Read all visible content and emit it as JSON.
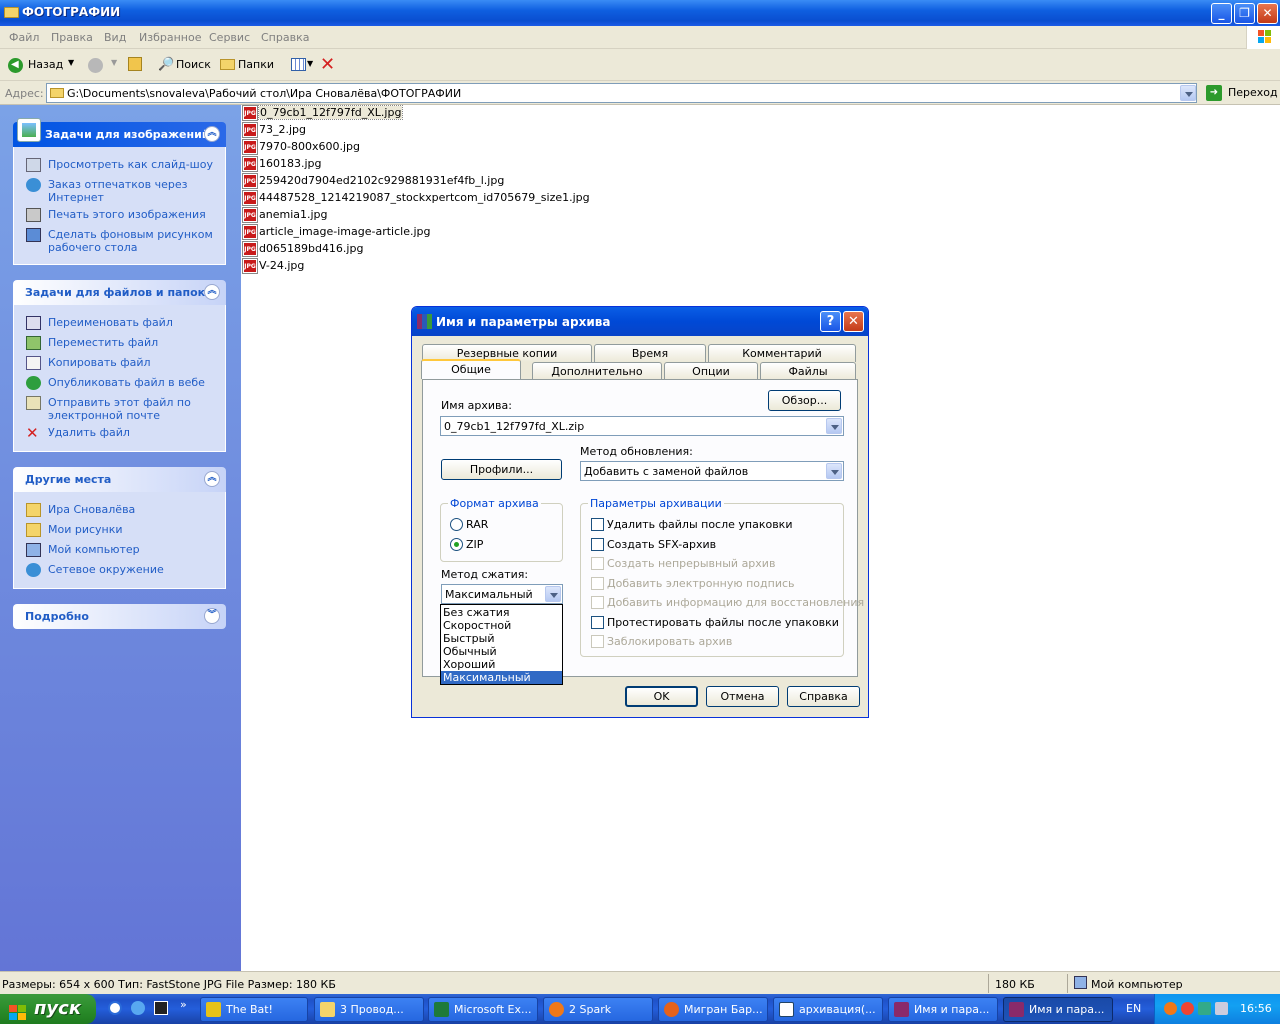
{
  "window": {
    "title": "ФОТОГРАФИИ"
  },
  "menu": [
    "Файл",
    "Правка",
    "Вид",
    "Избранное",
    "Сервис",
    "Справка"
  ],
  "toolbar": {
    "back": "Назад",
    "search": "Поиск",
    "folders": "Папки"
  },
  "address": {
    "label": "Адрес:",
    "path": "G:\\Documents\\snovaleva\\Рабочий стол\\Ира Сновалёва\\ФОТОГРАФИИ",
    "go": "Переход"
  },
  "panels": {
    "image_tasks": {
      "title": "Задачи для изображений",
      "items": [
        "Просмотреть как слайд-шоу",
        "Заказ отпечатков через Интернет",
        "Печать этого изображения",
        "Сделать фоновым рисунком рабочего стола"
      ]
    },
    "file_tasks": {
      "title": "Задачи для файлов и папок",
      "items": [
        "Переименовать файл",
        "Переместить файл",
        "Копировать файл",
        "Опубликовать файл в вебе",
        "Отправить этот файл по электронной почте",
        "Удалить файл"
      ]
    },
    "other_places": {
      "title": "Другие места",
      "items": [
        "Ира Сновалёва",
        "Мои рисунки",
        "Мой компьютер",
        "Сетевое окружение"
      ]
    },
    "details": {
      "title": "Подробно"
    }
  },
  "files": [
    "0_79cb1_12f797fd_XL.jpg",
    "73_2.jpg",
    "7970-800x600.jpg",
    "160183.jpg",
    "259420d7904ed2102c929881931ef4fb_l.jpg",
    "44487528_1214219087_stockxpertcom_id705679_size1.jpg",
    "anemia1.jpg",
    "article_image-image-article.jpg",
    "d065189bd416.jpg",
    "V-24.jpg"
  ],
  "file_icon_label": "JPG",
  "dialog": {
    "title": "Имя и параметры архива",
    "tabs_back": [
      "Резервные копии",
      "Время",
      "Комментарий"
    ],
    "tabs_front": [
      "Общие",
      "Дополнительно",
      "Опции",
      "Файлы"
    ],
    "archive_name_label": "Имя архива:",
    "archive_name": "0_79cb1_12f797fd_XL.zip",
    "browse": "Обзор...",
    "profiles": "Профили...",
    "update_method_label": "Метод обновления:",
    "update_method": "Добавить с заменой файлов",
    "format_group": "Формат архива",
    "format_rar": "RAR",
    "format_zip": "ZIP",
    "compression_label": "Метод сжатия:",
    "compression_value": "Максимальный",
    "compression_options": [
      "Без сжатия",
      "Скоростной",
      "Быстрый",
      "Обычный",
      "Хороший",
      "Максимальный"
    ],
    "params_group": "Параметры архивации",
    "params": [
      {
        "label": "Удалить файлы после упаковки",
        "enabled": true
      },
      {
        "label": "Создать SFX-архив",
        "enabled": true
      },
      {
        "label": "Создать непрерывный архив",
        "enabled": false
      },
      {
        "label": "Добавить электронную подпись",
        "enabled": false
      },
      {
        "label": "Добавить информацию для восстановления",
        "enabled": false
      },
      {
        "label": "Протестировать файлы после упаковки",
        "enabled": true
      },
      {
        "label": "Заблокировать архив",
        "enabled": false
      }
    ],
    "ok": "OK",
    "cancel": "Отмена",
    "help": "Справка"
  },
  "status": {
    "info": "Размеры: 654 x 600 Тип: FastStone JPG File Размер: 180 КБ",
    "size": "180 КБ",
    "location": "Мой компьютер"
  },
  "taskbar": {
    "start": "пуск",
    "buttons": [
      "The Bat!",
      "3 Провод...",
      "Microsoft Ex...",
      "2 Spark",
      "Мигран Бар...",
      "архивация(...",
      "Имя и пара...",
      "Имя и пара..."
    ],
    "lang": "EN",
    "clock": "16:56"
  },
  "colors": {
    "accent": "#0054e3",
    "link": "#215dc6",
    "selection": "#316ac5"
  }
}
